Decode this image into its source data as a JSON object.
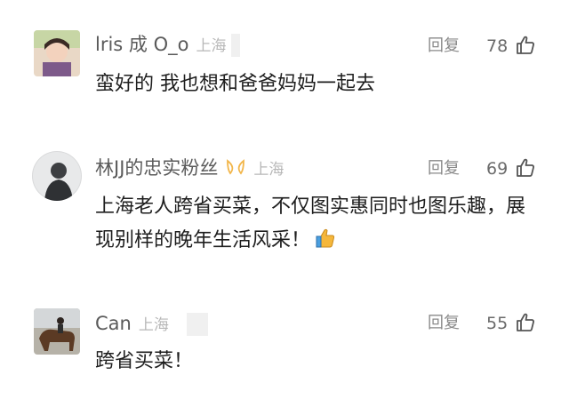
{
  "comments": [
    {
      "username": "lris 成 O_o",
      "location": "上海",
      "reply_label": "回复",
      "likes": "78",
      "text": "蛮好的 我也想和爸爸妈妈一起去",
      "avatar_icon": "girl-avatar-photo"
    },
    {
      "username": "林JJ的忠实粉丝",
      "location": "上海",
      "reply_label": "回复",
      "likes": "69",
      "text": "上海老人跨省买菜，不仅图实惠同时也图乐趣，展现别样的晚年生活风采！",
      "badge_icon": "fan-badge-icon",
      "emoji_icon": "thumbs-up-emoji",
      "avatar_icon": "silhouette-avatar-photo"
    },
    {
      "username": "Can",
      "location": "上海",
      "reply_label": "回复",
      "likes": "55",
      "text": "跨省买菜！",
      "avatar_icon": "horse-rider-avatar-photo"
    }
  ],
  "colors": {
    "username": "#5a5a5a",
    "location": "#b7b7b7",
    "body_text": "#1e1e1e",
    "badge": "#f2b64a",
    "emoji": "#f5b73b"
  }
}
